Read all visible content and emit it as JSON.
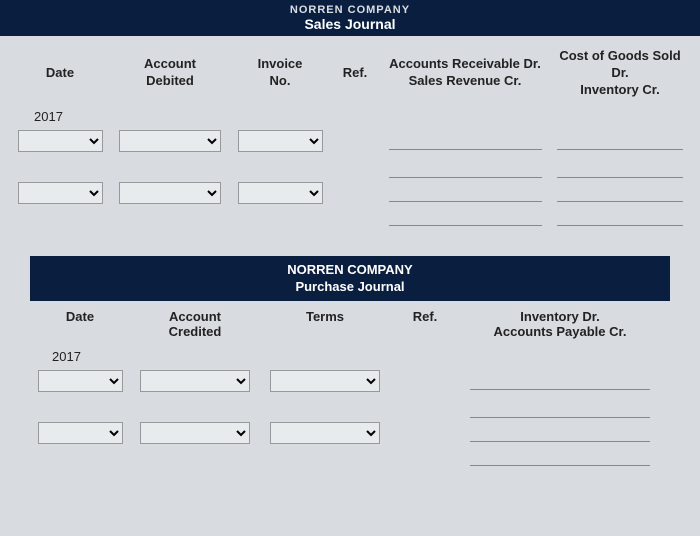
{
  "sales": {
    "company": "NORREN COMPANY",
    "title": "Sales Journal",
    "headers": {
      "date": "Date",
      "account": "Account\nDebited",
      "invoice": "Invoice\nNo.",
      "ref": "Ref.",
      "arsr": "Accounts Receivable Dr.\nSales Revenue Cr.",
      "cogs": "Cost of Goods Sold Dr.\nInventory Cr."
    },
    "year": "2017"
  },
  "purchase": {
    "company": "NORREN COMPANY",
    "title": "Purchase Journal",
    "headers": {
      "date": "Date",
      "account": "Account\nCredited",
      "terms": "Terms",
      "ref": "Ref.",
      "inv": "Inventory Dr.\nAccounts Payable Cr."
    },
    "year": "2017"
  }
}
